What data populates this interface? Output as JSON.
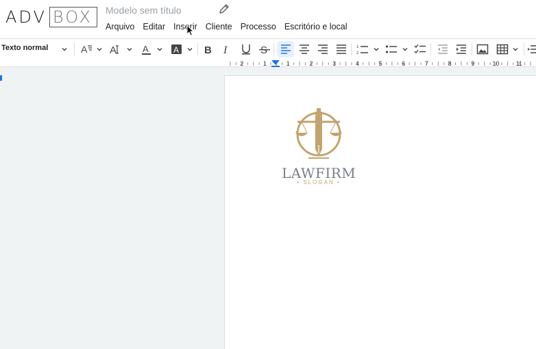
{
  "app": {
    "logo_left": "ADV",
    "logo_right": "BOX",
    "doc_title": "Modelo sem título"
  },
  "menu": [
    "Arquivo",
    "Editar",
    "Inserir",
    "Cliente",
    "Processo",
    "Escritório e local"
  ],
  "toolbar": {
    "paragraph_style": "Texto normal",
    "active_alignment": "align-left",
    "icons": [
      "font-size-icon",
      "line-height-icon",
      "text-color-icon",
      "highlight-icon",
      "bold-icon",
      "italic-icon",
      "underline-icon",
      "strikethrough-icon",
      "align-left-icon",
      "align-center-icon",
      "align-right-icon",
      "align-justify-icon",
      "numbered-list-icon",
      "bulleted-list-icon",
      "checklist-icon",
      "decrease-indent-icon",
      "increase-indent-icon",
      "image-icon",
      "table-icon"
    ]
  },
  "ruler": {
    "labels": [
      "2",
      "1",
      "1",
      "2",
      "3",
      "4",
      "5",
      "6",
      "7",
      "8",
      "9",
      "10",
      "11"
    ]
  },
  "document": {
    "firm_name": "LAWFIRM",
    "firm_slogan": "• SLOGAN •"
  },
  "colors": {
    "accent": "#1a73e8",
    "gold": "#c3a36f",
    "canvas": "#f0f3f4"
  }
}
